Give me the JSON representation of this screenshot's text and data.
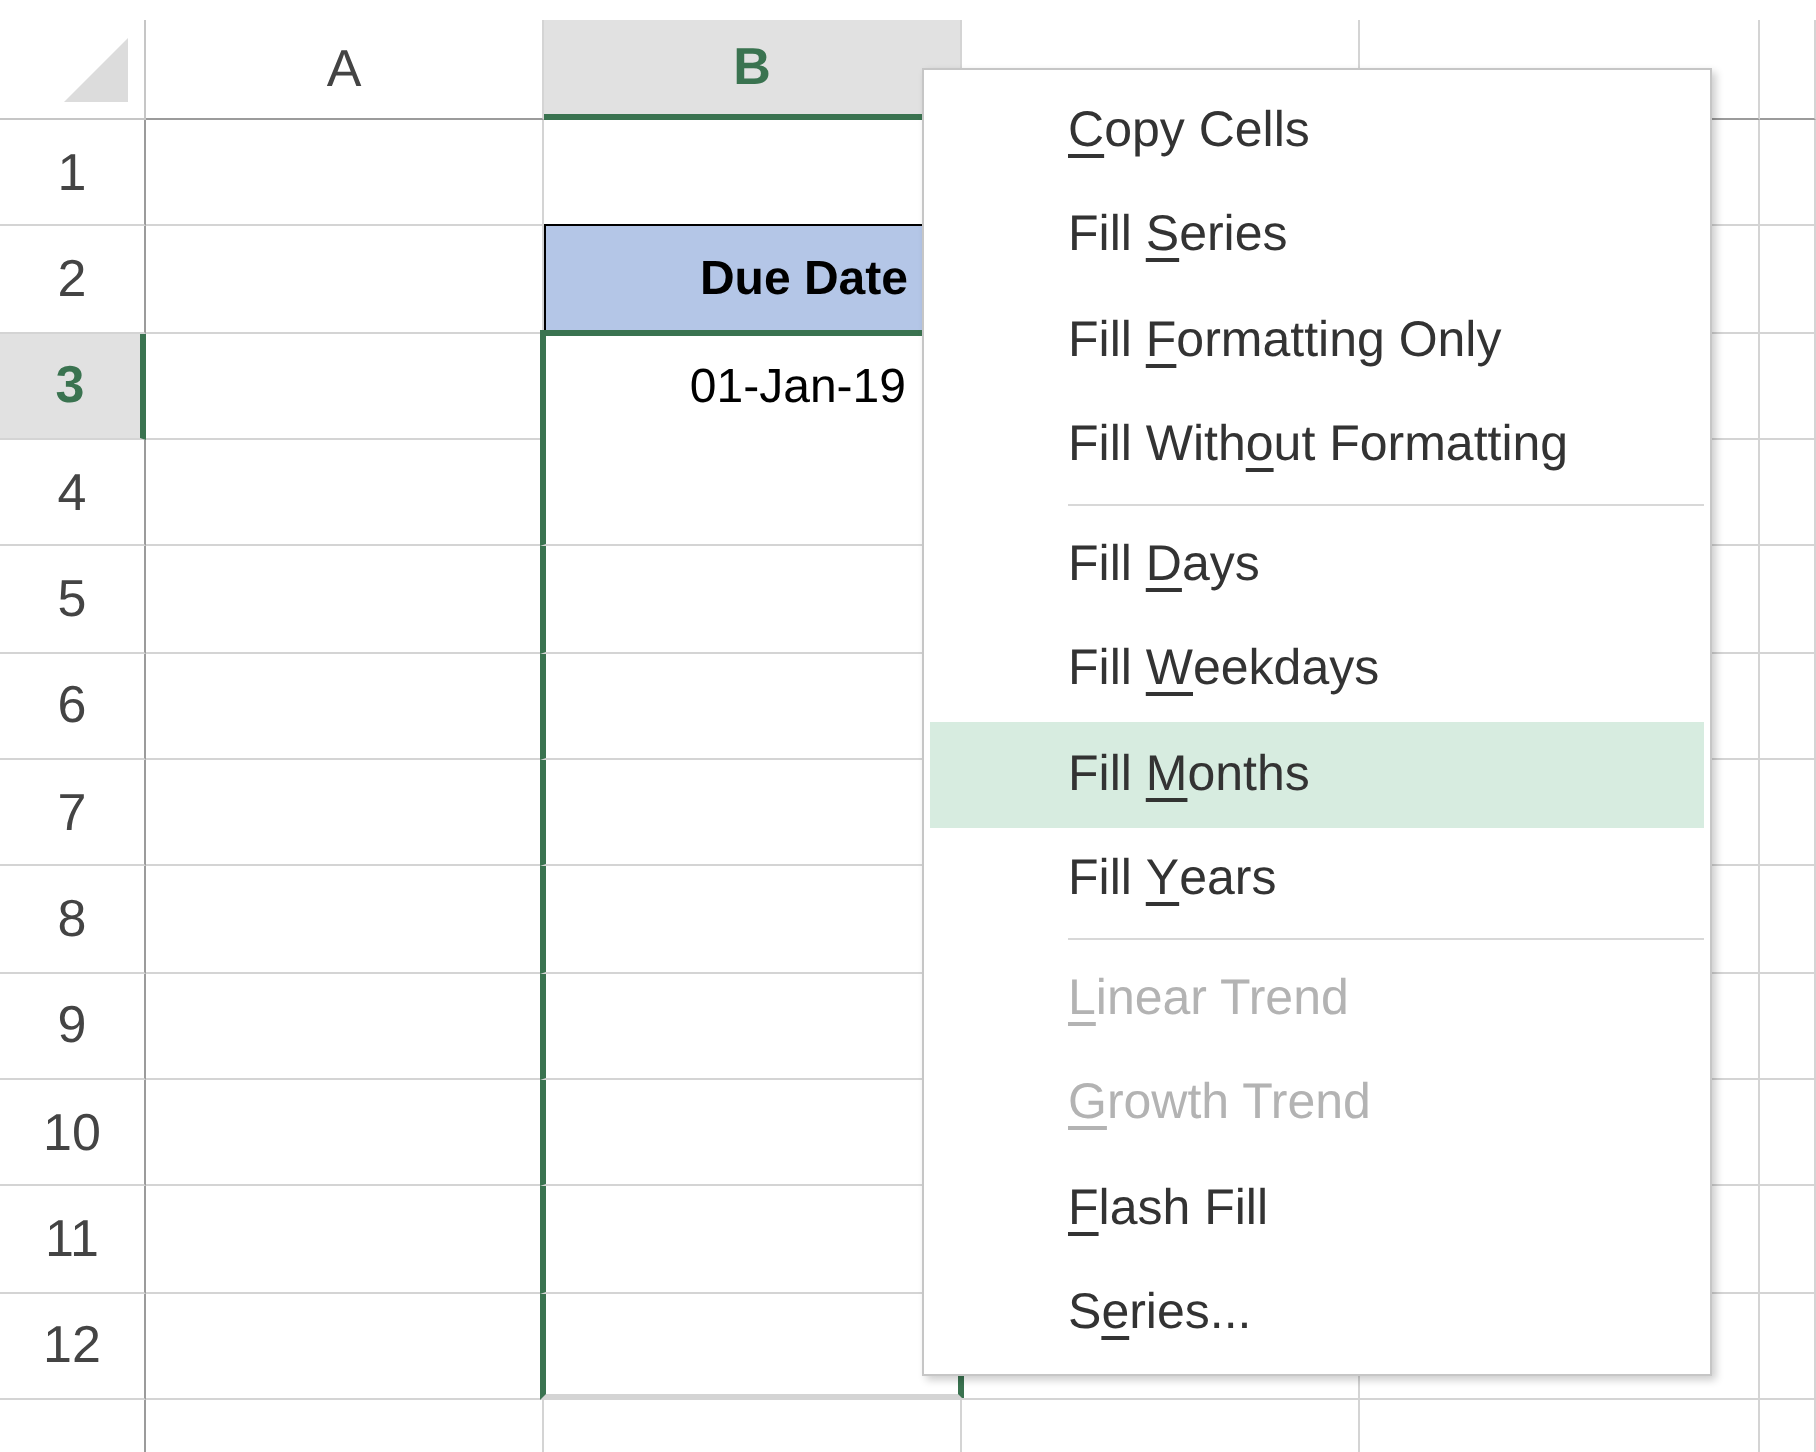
{
  "column_headers": [
    {
      "label": "A",
      "selected": false
    },
    {
      "label": "B",
      "selected": true
    },
    {
      "selected": false
    },
    {
      "selected": false
    },
    {
      "selected": false
    }
  ],
  "rows": [
    {
      "number": "1",
      "selected": false,
      "in_range": false
    },
    {
      "number": "2",
      "selected": false,
      "in_range": false,
      "column_b": {
        "text": "Due Date",
        "kind": "header"
      }
    },
    {
      "number": "3",
      "selected": true,
      "in_range": true,
      "column_b": {
        "text": "01-Jan-19",
        "kind": "value"
      }
    },
    {
      "number": "4",
      "selected": false,
      "in_range": true
    },
    {
      "number": "5",
      "selected": false,
      "in_range": true
    },
    {
      "number": "6",
      "selected": false,
      "in_range": true
    },
    {
      "number": "7",
      "selected": false,
      "in_range": true
    },
    {
      "number": "8",
      "selected": false,
      "in_range": true
    },
    {
      "number": "9",
      "selected": false,
      "in_range": true
    },
    {
      "number": "10",
      "selected": false,
      "in_range": true
    },
    {
      "number": "11",
      "selected": false,
      "in_range": true
    },
    {
      "number": "12",
      "selected": false,
      "in_range": true
    }
  ],
  "context_menu": [
    {
      "kind": "item",
      "key": "C",
      "after": "opy Cells",
      "selected": false,
      "disabled": false
    },
    {
      "kind": "item",
      "before": "Fill ",
      "key": "S",
      "after": "eries",
      "selected": false,
      "disabled": false
    },
    {
      "kind": "item",
      "before": "Fill ",
      "key": "F",
      "after": "ormatting Only",
      "selected": false,
      "disabled": false
    },
    {
      "kind": "item",
      "before": "Fill With",
      "key": "o",
      "after": "ut Formatting",
      "selected": false,
      "disabled": false
    },
    {
      "kind": "separator"
    },
    {
      "kind": "item",
      "before": "Fill ",
      "key": "D",
      "after": "ays",
      "selected": false,
      "disabled": false
    },
    {
      "kind": "item",
      "before": "Fill ",
      "key": "W",
      "after": "eekdays",
      "selected": false,
      "disabled": false
    },
    {
      "kind": "item",
      "before": "Fill ",
      "key": "M",
      "after": "onths",
      "selected": true,
      "disabled": false
    },
    {
      "kind": "item",
      "before": "Fill ",
      "key": "Y",
      "after": "ears",
      "selected": false,
      "disabled": false
    },
    {
      "kind": "separator"
    },
    {
      "kind": "item",
      "key": "L",
      "after": "inear Trend",
      "selected": false,
      "disabled": true
    },
    {
      "kind": "item",
      "key": "G",
      "after": "rowth Trend",
      "selected": false,
      "disabled": true
    },
    {
      "kind": "item",
      "key": "F",
      "after": "lash Fill",
      "selected": false,
      "disabled": false
    },
    {
      "kind": "item",
      "before": "S",
      "key": "e",
      "after": "ries...",
      "selected": false,
      "disabled": false
    }
  ]
}
